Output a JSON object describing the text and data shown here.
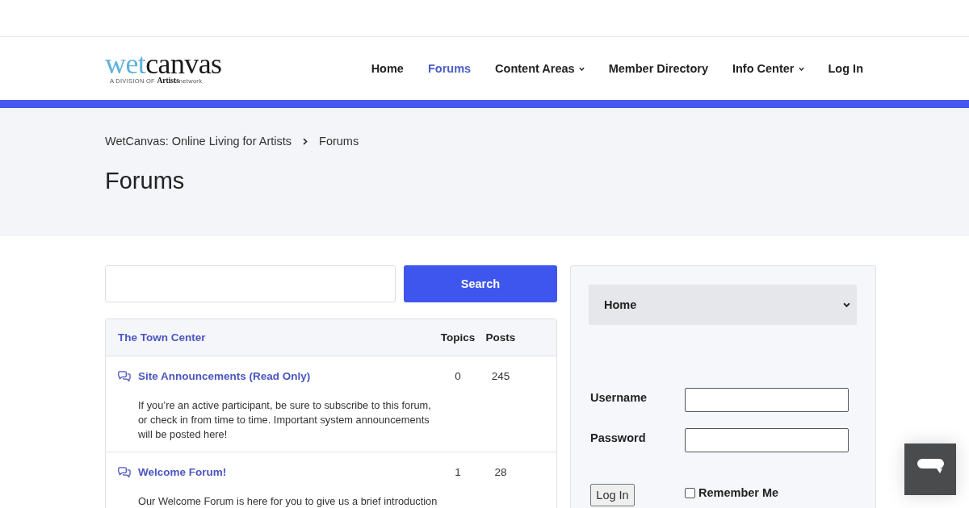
{
  "header": {
    "logo": {
      "wordmark": [
        "wet",
        "canvas"
      ],
      "tagline": "A DIVISION OF **Artists**network"
    },
    "nav": [
      {
        "label": "Home",
        "selected": false,
        "dropdown": false
      },
      {
        "label": "Forums",
        "selected": true,
        "dropdown": false
      },
      {
        "label": "Content Areas",
        "selected": false,
        "dropdown": true
      },
      {
        "label": "Member Directory",
        "selected": false,
        "dropdown": false
      },
      {
        "label": "Info Center",
        "selected": false,
        "dropdown": true
      },
      {
        "label": "Log In",
        "selected": false,
        "dropdown": false
      }
    ]
  },
  "page_header": {
    "breadcrumb": [
      "WetCanvas: Online Living for Artists",
      "Forums"
    ],
    "title": "Forums"
  },
  "search": {
    "button": "Search"
  },
  "forum_table": {
    "category": "The Town Center",
    "columns": [
      "Topics",
      "Posts"
    ],
    "forums": [
      {
        "title": "Site Announcements (Read Only)",
        "topics": "0",
        "posts": "245",
        "description": "If you’re an active participant, be sure to subscribe to this forum, or check in from time to time. Important system announcements will be posted here!"
      },
      {
        "title": "Welcome Forum!",
        "topics": "1",
        "posts": "28",
        "description": "Our Welcome Forum is here for you to give us a brief introduction"
      }
    ]
  },
  "sidebar": {
    "select": {
      "value": "Home"
    },
    "login": {
      "fields": [
        {
          "label": "Username"
        },
        {
          "label": "Password"
        }
      ],
      "button": "Log In",
      "remember": {
        "label": "Remember Me",
        "checked": false
      }
    }
  }
}
